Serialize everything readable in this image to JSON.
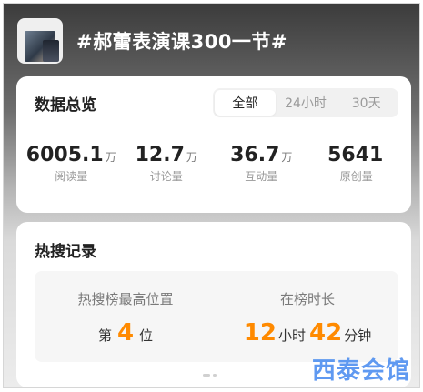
{
  "header": {
    "title": "#郝蕾表演课300一节#",
    "thumbnail_icon": "topic-thumbnail"
  },
  "overview": {
    "title": "数据总览",
    "tabs": [
      {
        "label": "全部",
        "active": true
      },
      {
        "label": "24小时",
        "active": false
      },
      {
        "label": "30天",
        "active": false
      }
    ],
    "stats": [
      {
        "value": "6005.1",
        "unit": "万",
        "label": "阅读量"
      },
      {
        "value": "12.7",
        "unit": "万",
        "label": "讨论量"
      },
      {
        "value": "36.7",
        "unit": "万",
        "label": "互动量"
      },
      {
        "value": "5641",
        "unit": "",
        "label": "原创量"
      }
    ]
  },
  "hot_search": {
    "title": "热搜记录",
    "highest_position": {
      "label": "热搜榜最高位置",
      "prefix": "第",
      "value": "4",
      "suffix": "位"
    },
    "duration": {
      "label": "在榜时长",
      "hours": "12",
      "hours_unit": "小时",
      "minutes": "42",
      "minutes_unit": "分钟"
    }
  },
  "watermark": "西泰会馆",
  "colors": {
    "accent": "#ff8a00",
    "watermark": "#4e8ff0"
  }
}
